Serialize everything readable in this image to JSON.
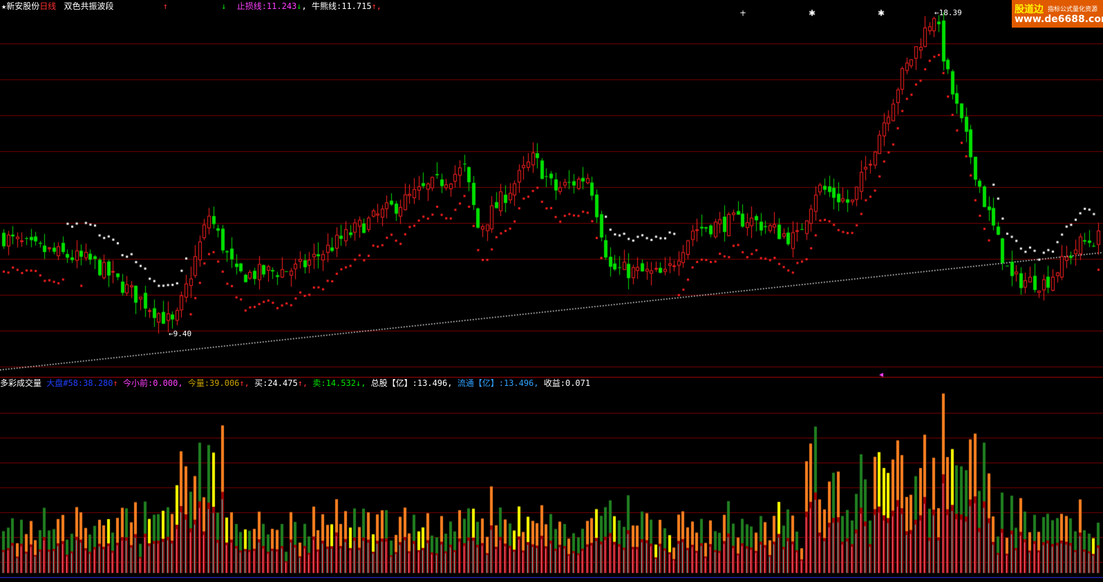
{
  "header": {
    "star": "★",
    "stock_name": "新安股份",
    "period": "日线",
    "indicator": "双色共振波段",
    "arrow_up": "↑",
    "arrow_down": "↓",
    "stop_label": "止损线:",
    "stop_value": "11.243",
    "stop_arrow": "↓",
    "bull_label": "牛熊线:",
    "bull_value": "11.715",
    "bull_arrow": "↑,"
  },
  "volume_header": {
    "title": "多彩成交量",
    "big_label": "大盘#58:",
    "big_value": "38.280",
    "big_arrow": "↑",
    "small_label": "今小前:",
    "small_value": "0.000,",
    "vol_label": "今量:",
    "vol_value": "39.006",
    "vol_arrow": "↑,",
    "buy_label": "买:",
    "buy_value": "24.475",
    "buy_arrow": "↑,",
    "sell_label": "卖:",
    "sell_value": "14.532",
    "sell_arrow": "↓,",
    "total_label": "总股【亿】:",
    "total_value": "13.496,",
    "float_label": "流通【亿】:",
    "float_value": "13.496,",
    "profit_label": "收益:",
    "profit_value": "0.071"
  },
  "annotations": {
    "high_label": "←18.39",
    "low_label": "←9.40"
  },
  "logo": {
    "brand": "股道边",
    "slogan": "指标公式量化资源",
    "url": "www.de6688.com"
  },
  "chart_data": {
    "type": "candlestick_with_volume",
    "title": "双色共振波段",
    "price_high": 18.39,
    "price_low": 9.4,
    "stop_line": 11.243,
    "bull_bear_line": 11.715,
    "colors": {
      "up_candle": "#ff2020",
      "down_candle": "#00e000",
      "stop_line_up": "#ff2020",
      "stop_line_down": "#ffffff",
      "long_ma": "#ffffff",
      "grid": "#7a0000",
      "vol_orange": "#ff8020",
      "vol_green": "#208020",
      "vol_yellow": "#ffff00",
      "vol_darkred": "#a00000"
    },
    "markers": [
      "+",
      "✱",
      "✱"
    ]
  }
}
